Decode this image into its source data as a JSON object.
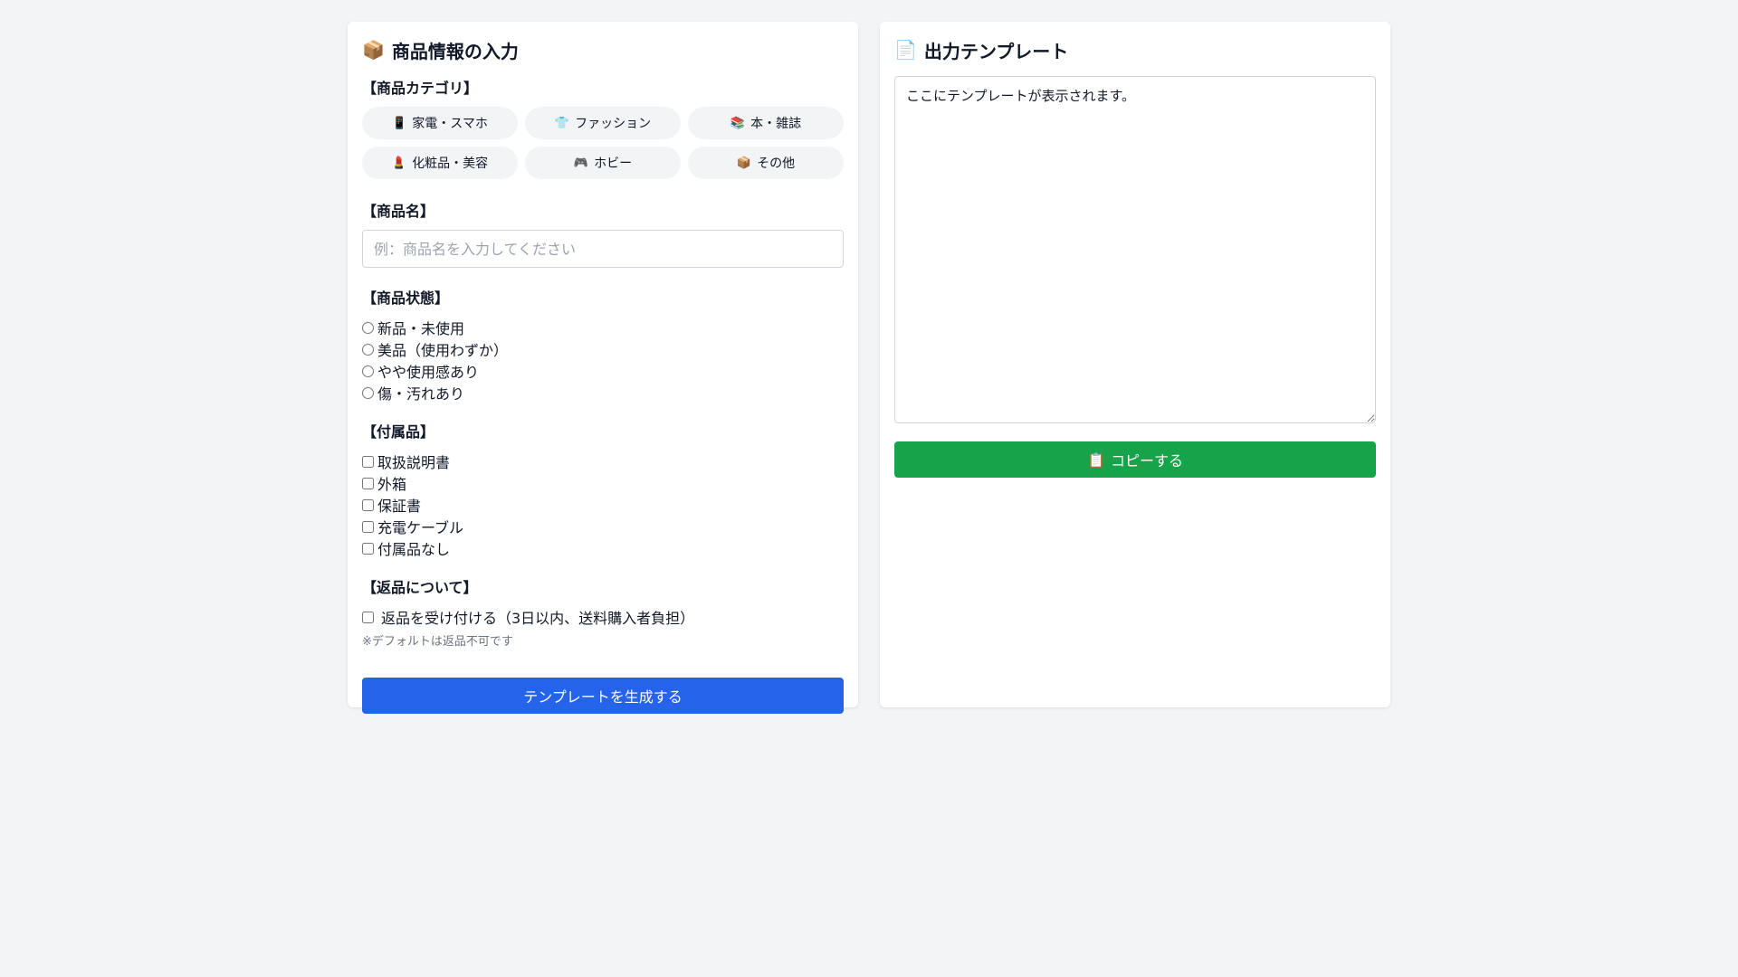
{
  "left": {
    "title_icon": "📦",
    "title": "商品情報の入力",
    "category": {
      "heading": "【商品カテゴリ】",
      "items": [
        {
          "icon": "📱",
          "label": "家電・スマホ"
        },
        {
          "icon": "👕",
          "label": "ファッション"
        },
        {
          "icon": "📚",
          "label": "本・雑誌"
        },
        {
          "icon": "💄",
          "label": "化粧品・美容"
        },
        {
          "icon": "🎮",
          "label": "ホビー"
        },
        {
          "icon": "📦",
          "label": "その他"
        }
      ]
    },
    "name": {
      "heading": "【商品名】",
      "placeholder": "例：商品名を入力してください",
      "value": ""
    },
    "condition": {
      "heading": "【商品状態】",
      "options": [
        "新品・未使用",
        "美品（使用わずか）",
        "やや使用感あり",
        "傷・汚れあり"
      ]
    },
    "accessories": {
      "heading": "【付属品】",
      "options": [
        "取扱説明書",
        "外箱",
        "保証書",
        "充電ケーブル",
        "付属品なし"
      ]
    },
    "returns": {
      "heading": "【返品について】",
      "option": "返品を受け付ける（3日以内、送料購入者負担）",
      "note": "※デフォルトは返品不可です"
    },
    "generate_label": "テンプレートを生成する"
  },
  "right": {
    "title_icon": "📄",
    "title": "出力テンプレート",
    "output_text": "ここにテンプレートが表示されます。",
    "copy_icon": "📋",
    "copy_label": "コピーする"
  },
  "colors": {
    "primary": "#2563eb",
    "success": "#16a34a",
    "background": "#f3f4f6"
  }
}
